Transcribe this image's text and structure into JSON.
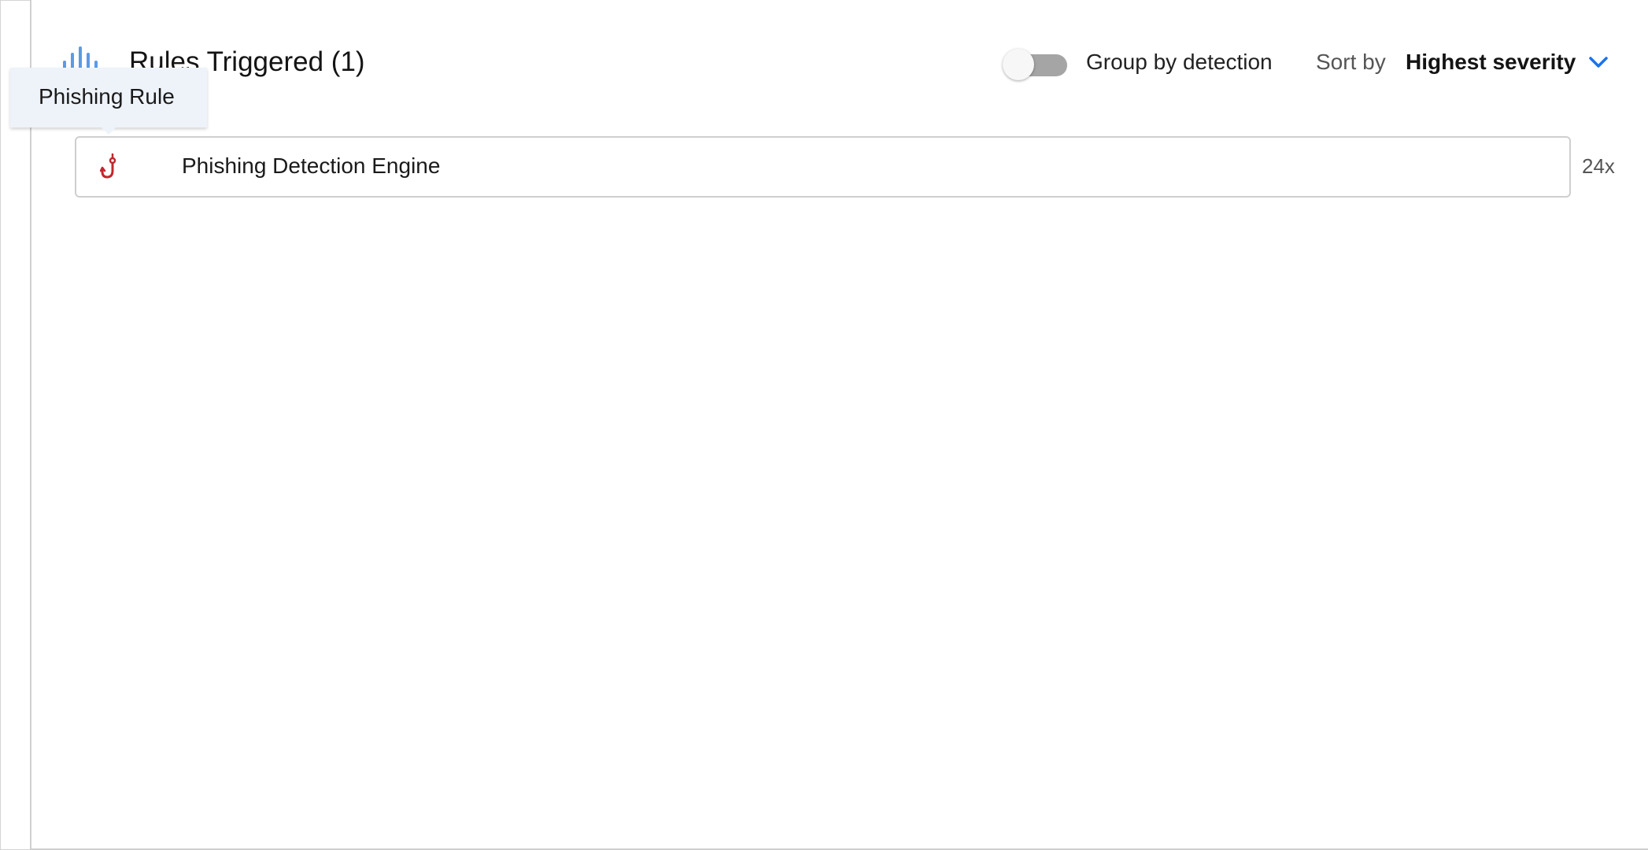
{
  "header": {
    "title": "Rules Triggered (1)",
    "group_toggle": {
      "label": "Group by detection",
      "enabled": false
    },
    "sort": {
      "label": "Sort by",
      "value": "Highest severity"
    }
  },
  "rules": [
    {
      "name": "Phishing Detection Engine",
      "count": "24x",
      "icon": "fishing-hook-icon"
    }
  ],
  "tooltip": {
    "text": "Phishing Rule"
  },
  "colors": {
    "accent": "#1a73e8",
    "chart_icon": "#5b9be6",
    "hook_icon": "#c2272d",
    "toggle_track": "#a5a5a5"
  }
}
